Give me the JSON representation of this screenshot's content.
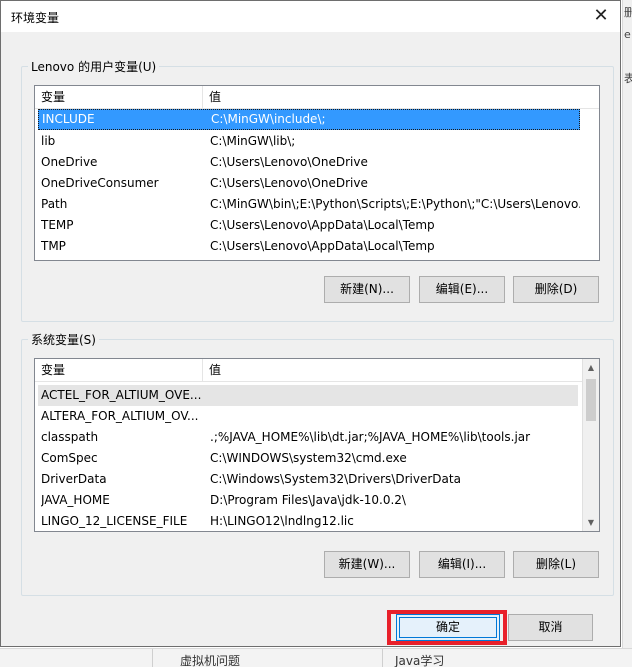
{
  "dialog": {
    "title": "环境变量",
    "close_glyph": "✕"
  },
  "user_vars": {
    "legend": "Lenovo 的用户变量(U)",
    "columns": [
      "变量",
      "值"
    ],
    "rows": [
      {
        "name": "INCLUDE",
        "value": "C:\\MinGW\\include\\;"
      },
      {
        "name": "lib",
        "value": "C:\\MinGW\\lib\\;"
      },
      {
        "name": "OneDrive",
        "value": "C:\\Users\\Lenovo\\OneDrive"
      },
      {
        "name": "OneDriveConsumer",
        "value": "C:\\Users\\Lenovo\\OneDrive"
      },
      {
        "name": "Path",
        "value": "C:\\MinGW\\bin\\;E:\\Python\\Scripts\\;E:\\Python\\;\"C:\\Users\\Lenovo..."
      },
      {
        "name": "TEMP",
        "value": "C:\\Users\\Lenovo\\AppData\\Local\\Temp"
      },
      {
        "name": "TMP",
        "value": "C:\\Users\\Lenovo\\AppData\\Local\\Temp"
      }
    ],
    "new_label": "新建(N)...",
    "edit_label": "编辑(E)...",
    "delete_label": "删除(D)"
  },
  "system_vars": {
    "legend": "系统变量(S)",
    "columns": [
      "变量",
      "值"
    ],
    "rows": [
      {
        "name": "ACTEL_FOR_ALTIUM_OVE...",
        "value": ""
      },
      {
        "name": "ALTERA_FOR_ALTIUM_OV...",
        "value": ""
      },
      {
        "name": "classpath",
        "value": ".;%JAVA_HOME%\\lib\\dt.jar;%JAVA_HOME%\\lib\\tools.jar"
      },
      {
        "name": "ComSpec",
        "value": "C:\\WINDOWS\\system32\\cmd.exe"
      },
      {
        "name": "DriverData",
        "value": "C:\\Windows\\System32\\Drivers\\DriverData"
      },
      {
        "name": "JAVA_HOME",
        "value": "D:\\Program Files\\Java\\jdk-10.0.2\\"
      },
      {
        "name": "LINGO_12_LICENSE_FILE",
        "value": "H:\\LINGO12\\lndlng12.lic"
      }
    ],
    "new_label": "新建(W)...",
    "edit_label": "编辑(I)...",
    "delete_label": "删除(L)"
  },
  "footer": {
    "ok_label": "确定",
    "cancel_label": "取消"
  },
  "background": {
    "right_fragments": [
      "删",
      "e",
      "表"
    ],
    "bottom_left_text": "虚拟机问题",
    "bottom_right_text": "Java学习"
  },
  "colors": {
    "selection": "#3399ff",
    "highlight_box": "#e8202a"
  }
}
